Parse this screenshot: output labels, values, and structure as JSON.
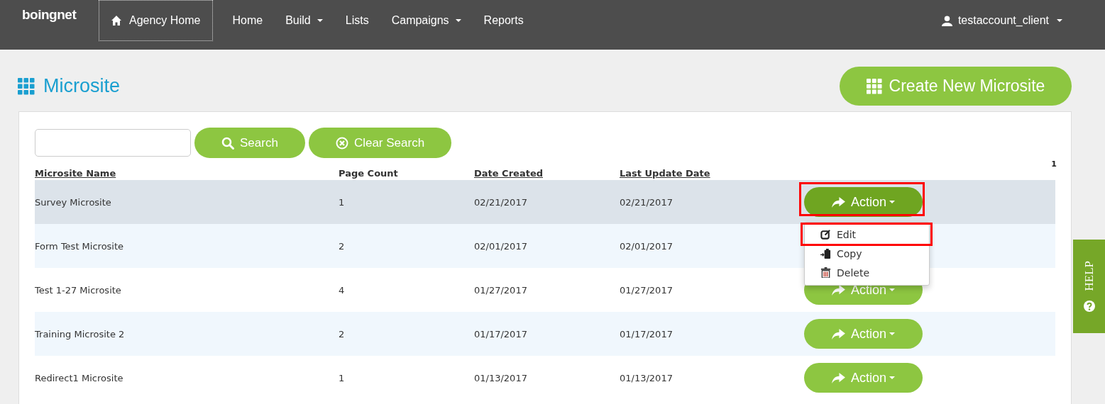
{
  "navbar": {
    "logo": "boingnet",
    "agency_home": {
      "label": "Agency Home",
      "focused": true
    },
    "items": [
      {
        "label": "Home",
        "dropdown": false
      },
      {
        "label": "Build",
        "dropdown": true
      },
      {
        "label": "Lists",
        "dropdown": false
      },
      {
        "label": "Campaigns",
        "dropdown": true
      },
      {
        "label": "Reports",
        "dropdown": false
      }
    ],
    "user": "testaccount_client"
  },
  "page": {
    "title": "Microsite",
    "create_button": "Create New Microsite"
  },
  "search": {
    "search_button": "Search",
    "clear_button": "Clear Search"
  },
  "pagination": "1",
  "table": {
    "columns": [
      {
        "label": "Microsite Name",
        "sortable": true
      },
      {
        "label": "Page Count",
        "sortable": false
      },
      {
        "label": "Date Created",
        "sortable": true
      },
      {
        "label": "Last Update Date",
        "sortable": true
      }
    ],
    "rows": [
      {
        "name": "Survey Microsite",
        "page_count": "1",
        "date_created": "02/21/2017",
        "last_update": "02/21/2017",
        "action": "Action",
        "selected": true,
        "menu_open": true,
        "outlined": true
      },
      {
        "name": "Form Test Microsite",
        "page_count": "2",
        "date_created": "02/01/2017",
        "last_update": "02/01/2017",
        "selected": false,
        "menu_open": false,
        "outlined": false
      },
      {
        "name": "Test 1-27 Microsite",
        "page_count": "4",
        "date_created": "01/27/2017",
        "last_update": "01/27/2017",
        "action": "Action",
        "selected": false,
        "menu_open": false,
        "outlined": false
      },
      {
        "name": "Training Microsite 2",
        "page_count": "2",
        "date_created": "01/17/2017",
        "last_update": "01/17/2017",
        "action": "Action",
        "selected": false,
        "menu_open": false,
        "outlined": false
      },
      {
        "name": "Redirect1 Microsite",
        "page_count": "1",
        "date_created": "01/13/2017",
        "last_update": "01/13/2017",
        "action": "Action",
        "selected": false,
        "menu_open": false,
        "outlined": false
      }
    ]
  },
  "action_menu": [
    {
      "kind": "edit",
      "label": "Edit",
      "outlined": true
    },
    {
      "kind": "copy",
      "label": "Copy",
      "outlined": false
    },
    {
      "kind": "delete",
      "label": "Delete",
      "outlined": false
    }
  ],
  "help_tab": "HELP"
}
